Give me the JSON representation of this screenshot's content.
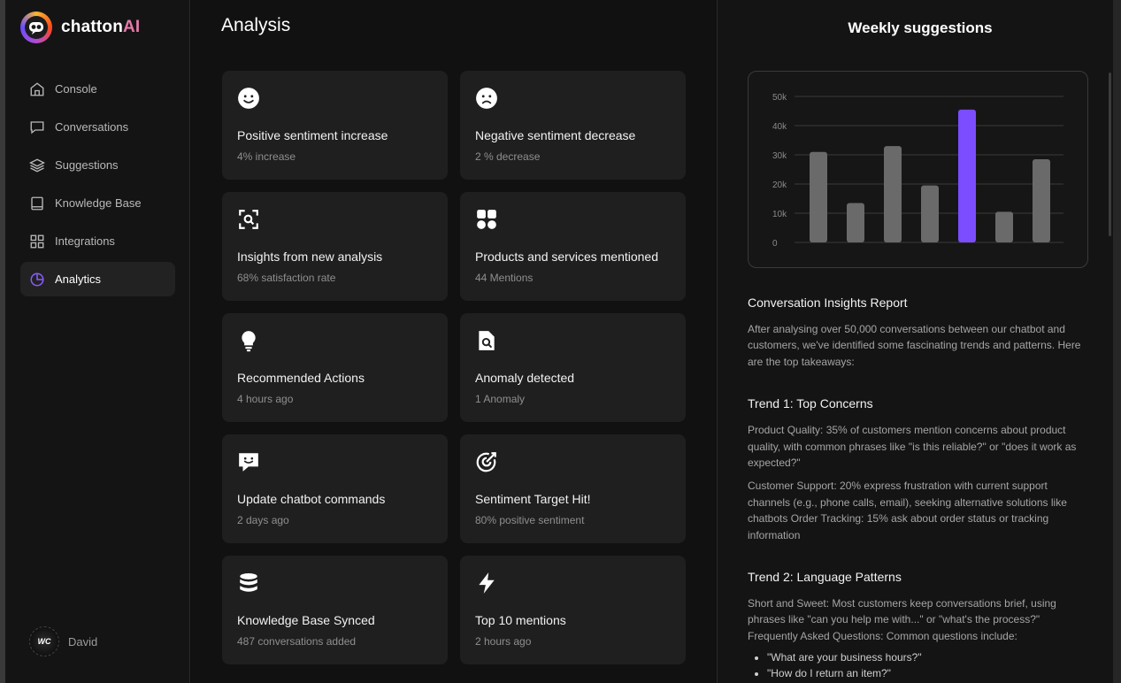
{
  "app": {
    "logo_main": "chatton",
    "logo_accent": "AI"
  },
  "sidebar": {
    "items": [
      {
        "label": "Console",
        "icon": "home-icon"
      },
      {
        "label": "Conversations",
        "icon": "chat-icon"
      },
      {
        "label": "Suggestions",
        "icon": "layers-icon"
      },
      {
        "label": "Knowledge Base",
        "icon": "book-icon"
      },
      {
        "label": "Integrations",
        "icon": "grid-icon"
      },
      {
        "label": "Analytics",
        "icon": "pie-chart-icon",
        "active": true
      }
    ],
    "user": {
      "initials": "WC",
      "name": "David"
    }
  },
  "main": {
    "title": "Analysis",
    "cards": [
      {
        "title": "Positive sentiment increase",
        "subtitle": "4% increase",
        "icon": "smile-icon"
      },
      {
        "title": "Negative sentiment decrease",
        "subtitle": "2 % decrease",
        "icon": "frown-icon"
      },
      {
        "title": "Insights from new analysis",
        "subtitle": "68% satisfaction rate",
        "icon": "scan-search-icon"
      },
      {
        "title": "Products and services mentioned",
        "subtitle": "44 Mentions",
        "icon": "shapes-icon"
      },
      {
        "title": "Recommended Actions",
        "subtitle": "4 hours ago",
        "icon": "lightbulb-icon"
      },
      {
        "title": "Anomaly detected",
        "subtitle": "1 Anomaly",
        "icon": "file-search-icon"
      },
      {
        "title": "Update chatbot commands",
        "subtitle": "2 days ago",
        "icon": "message-smile-icon"
      },
      {
        "title": "Sentiment Target Hit!",
        "subtitle": "80% positive sentiment",
        "icon": "target-icon"
      },
      {
        "title": "Knowledge Base Synced",
        "subtitle": "487 conversations added",
        "icon": "database-icon"
      },
      {
        "title": "Top 10 mentions",
        "subtitle": "2 hours ago",
        "icon": "bolt-icon"
      }
    ]
  },
  "panel": {
    "title": "Weekly suggestions",
    "report_title": "Conversation Insights Report",
    "intro": "After analysing over 50,000 conversations between our chatbot and customers, we've identified some fascinating trends and patterns. Here are the top takeaways:",
    "trend1_title": "Trend 1: Top Concerns",
    "trend1_p1": "Product Quality: 35% of customers mention concerns about product quality, with common phrases like \"is this reliable?\" or \"does it work as expected?\"",
    "trend1_p2": "Customer Support: 20% express frustration with current support channels (e.g., phone calls, email), seeking alternative solutions like chatbots Order Tracking: 15% ask about order status or tracking information",
    "trend2_title": "Trend 2: Language Patterns",
    "trend2_p1": "Short and Sweet: Most customers keep conversations brief, using phrases  like \"can you help me with...\" or \"what's the process?\" Frequently Asked Questions: Common questions include:",
    "bullets": [
      "\"What are your business hours?\"",
      "\"How do I return an item?\""
    ]
  },
  "chart_data": {
    "type": "bar",
    "values": [
      31000,
      13500,
      33000,
      19500,
      45500,
      10500,
      28500
    ],
    "highlight_index": 4,
    "ylim": [
      0,
      50000
    ],
    "yticks": [
      "0",
      "10k",
      "20k",
      "30k",
      "40k",
      "50k"
    ],
    "tick_values": [
      0,
      10000,
      20000,
      30000,
      40000,
      50000
    ],
    "grid": true,
    "colors": {
      "default": "#6a6a6a",
      "highlight": "#7b4dff"
    }
  }
}
